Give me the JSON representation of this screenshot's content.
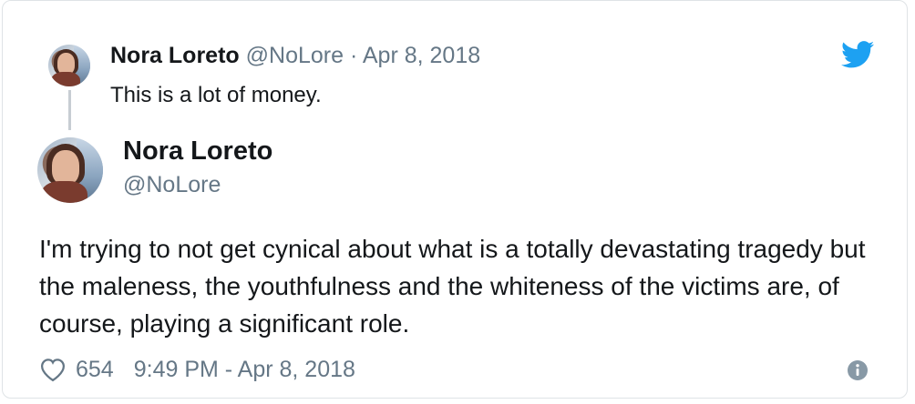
{
  "quoted_tweet": {
    "name": "Nora Loreto",
    "handle": "@NoLore",
    "separator": "·",
    "date": "Apr 8, 2018",
    "text": "This is a lot of money."
  },
  "main_tweet": {
    "name": "Nora Loreto",
    "handle": "@NoLore",
    "text": "I'm trying to not get cynical about what is a totally devastating tragedy but the maleness, the youthfulness and the whiteness of the victims are, of course, playing a significant role.",
    "likes": "654",
    "timestamp": "9:49 PM - Apr 8, 2018"
  },
  "colors": {
    "twitter_blue": "#1da1f2",
    "meta_gray": "#657786",
    "text": "#14171a"
  },
  "icons": {
    "brand": "twitter-bird-icon",
    "like": "heart-icon",
    "info": "info-icon"
  }
}
